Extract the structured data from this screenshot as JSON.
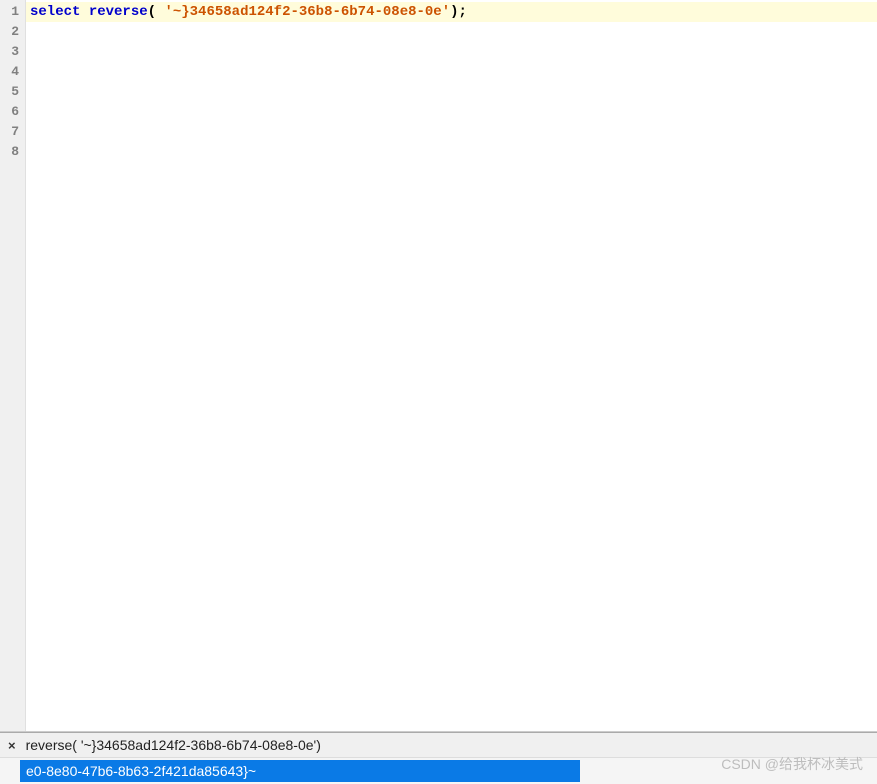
{
  "editor": {
    "lines": [
      {
        "num": "1",
        "current": true,
        "tokens": [
          {
            "t": "kw",
            "v": "select"
          },
          {
            "t": "plain",
            "v": " "
          },
          {
            "t": "kw",
            "v": "reverse"
          },
          {
            "t": "plain",
            "v": "( "
          },
          {
            "t": "str",
            "v": "'~}34658ad124f2-36b8-6b74-08e8-0e'"
          },
          {
            "t": "plain",
            "v": ");"
          }
        ]
      },
      {
        "num": "2",
        "current": false,
        "tokens": []
      },
      {
        "num": "3",
        "current": false,
        "tokens": []
      },
      {
        "num": "4",
        "current": false,
        "tokens": []
      },
      {
        "num": "5",
        "current": false,
        "tokens": []
      },
      {
        "num": "6",
        "current": false,
        "tokens": []
      },
      {
        "num": "7",
        "current": false,
        "tokens": []
      },
      {
        "num": "8",
        "current": false,
        "tokens": []
      }
    ]
  },
  "results": {
    "close_label": "×",
    "column_header": "reverse( '~}34658ad124f2-36b8-6b74-08e8-0e')",
    "row_value": "e0-8e80-47b6-8b63-2f421da85643}~"
  },
  "watermark": "CSDN @给我杯冰美式"
}
